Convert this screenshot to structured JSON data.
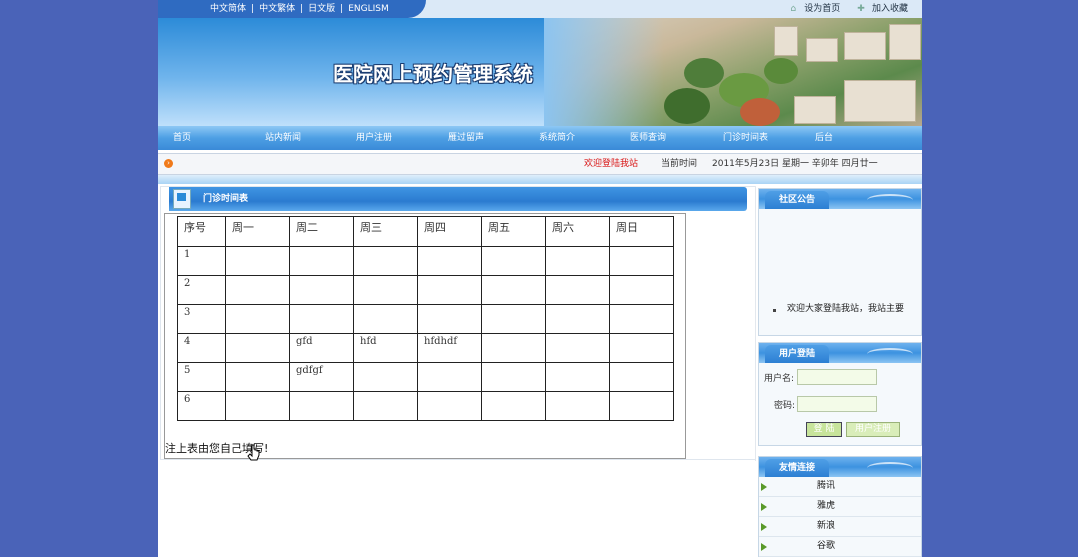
{
  "lang_links": [
    "中文简体",
    "中文繁体",
    "日文版",
    "ENGLISM"
  ],
  "lang_separator": "|",
  "top_links": {
    "set_home": "设为首页",
    "add_favorite": "加入收藏"
  },
  "banner_title": "医院网上预约管理系统",
  "nav": [
    "首页",
    "站内新闻",
    "用户注册",
    "雁过留声",
    "系统简介",
    "医师查询",
    "门诊时间表",
    "后台"
  ],
  "infobar": {
    "welcome": "欢迎登陆我站",
    "current_time_label": "当前时间",
    "date": "2011年5月23日 星期一 辛卯年 四月廿一"
  },
  "main": {
    "title": "门诊时间表",
    "table": {
      "headers": [
        "序号",
        "周一",
        "周二",
        "周三",
        "周四",
        "周五",
        "周六",
        "周日"
      ],
      "rows": [
        [
          "1",
          "",
          "",
          "",
          "",
          "",
          "",
          ""
        ],
        [
          "2",
          "",
          "",
          "",
          "",
          "",
          "",
          ""
        ],
        [
          "3",
          "",
          "",
          "",
          "",
          "",
          "",
          ""
        ],
        [
          "4",
          "",
          "gfd",
          "hfd",
          "hfdhdf",
          "",
          "",
          ""
        ],
        [
          "5",
          "",
          "gdfgf",
          "",
          "",
          "",
          "",
          ""
        ],
        [
          "6",
          "",
          "",
          "",
          "",
          "",
          "",
          ""
        ]
      ]
    },
    "note": "注上表由您自己填写!"
  },
  "sidebar": {
    "notice": {
      "title": "社区公告",
      "text": "欢迎大家登陆我站，我站主要"
    },
    "login": {
      "title": "用户登陆",
      "username_label": "用户名:",
      "password_label": "密码:",
      "login_button": "登 陆",
      "register_button": "用户注册"
    },
    "links": {
      "title": "友情连接",
      "items": [
        "腾讯",
        "雅虎",
        "新浪",
        "谷歌"
      ]
    }
  },
  "colors": {
    "background": "#4a63b8",
    "nav": "#3a8ad8",
    "welcome_text": "#d91414"
  }
}
